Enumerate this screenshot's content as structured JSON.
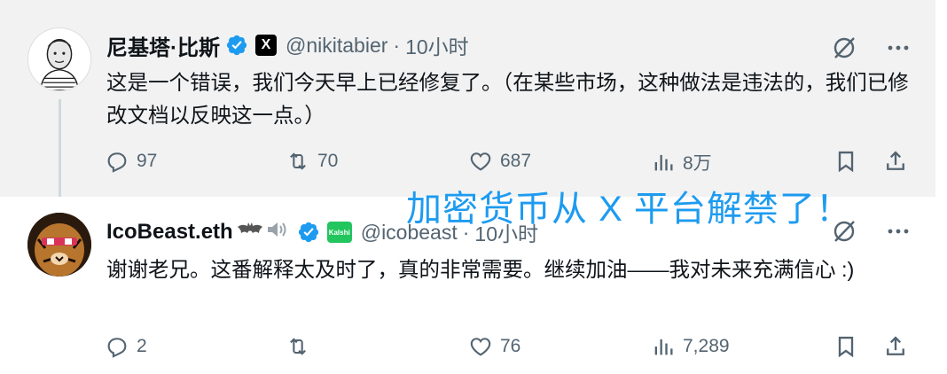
{
  "colors": {
    "verified": "#1d9bf0",
    "muted": "#536471",
    "overlay": "#1d9bf0",
    "reply_bg": "#f2f2f2"
  },
  "tweets": [
    {
      "name": "尼基塔·比斯",
      "badge": "X",
      "handle": "@nikitabier",
      "dot": "·",
      "time": "10小时",
      "text": "这是一个错误，我们今天早上已经修复了。（在某些市场，这种做法是违法的，我们已修改文档以反映这一点。）",
      "replies": "97",
      "reposts": "70",
      "likes": "687",
      "views": "8万"
    },
    {
      "name": "IcoBeast.eth",
      "name_emojis": [
        "bat",
        "speaker"
      ],
      "badge": "Kalshi",
      "handle": "@icobeast",
      "dot": "·",
      "time": "10小时",
      "text": "谢谢老兄。这番解释太及时了，真的非常需要。继续加油——我对未来充满信心 :)",
      "replies": "2",
      "reposts": "",
      "likes": "76",
      "views": "7,289"
    }
  ],
  "overlay_text": "加密货币从 X 平台解禁了！",
  "icons": [
    "verified-icon",
    "grok-icon",
    "more-icon",
    "reply-icon",
    "repost-icon",
    "like-icon",
    "views-icon",
    "bookmark-icon",
    "share-icon"
  ]
}
